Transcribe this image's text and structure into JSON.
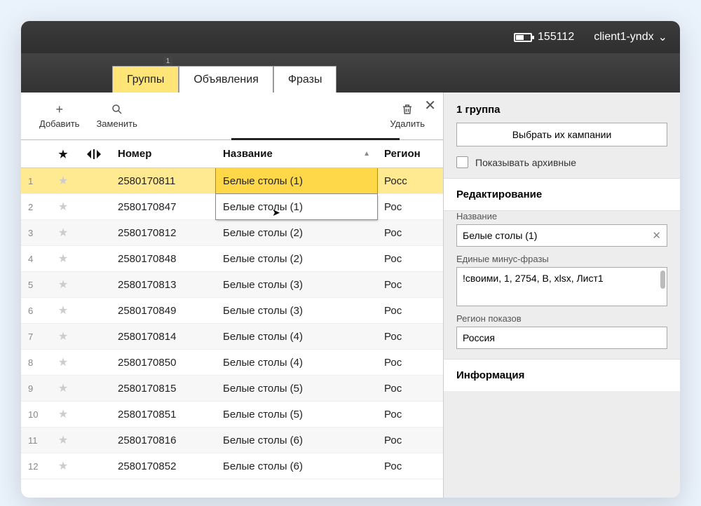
{
  "titlebar": {
    "id": "155112",
    "user": "client1-yndx"
  },
  "tabs": [
    {
      "label": "Группы",
      "active": true,
      "badge": "1"
    },
    {
      "label": "Объявления",
      "active": false
    },
    {
      "label": "Фразы",
      "active": false
    }
  ],
  "toolbar": {
    "add": "Добавить",
    "replace": "Заменить",
    "delete": "Удалить"
  },
  "columns": {
    "number": "Номер",
    "name": "Название",
    "region": "Регион"
  },
  "rows": [
    {
      "idx": "1",
      "num": "2580170811",
      "name": "Белые столы (1)",
      "region": "Росс",
      "selected": true
    },
    {
      "idx": "2",
      "num": "2580170847",
      "name": "Белые столы (1)",
      "region": "Рос",
      "editing": true
    },
    {
      "idx": "3",
      "num": "2580170812",
      "name": "Белые столы (2)",
      "region": "Рос"
    },
    {
      "idx": "4",
      "num": "2580170848",
      "name": "Белые столы (2)",
      "region": "Рос"
    },
    {
      "idx": "5",
      "num": "2580170813",
      "name": "Белые столы (3)",
      "region": "Рос"
    },
    {
      "idx": "6",
      "num": "2580170849",
      "name": "Белые столы (3)",
      "region": "Рос"
    },
    {
      "idx": "7",
      "num": "2580170814",
      "name": "Белые столы (4)",
      "region": "Рос"
    },
    {
      "idx": "8",
      "num": "2580170850",
      "name": "Белые столы (4)",
      "region": "Рос"
    },
    {
      "idx": "9",
      "num": "2580170815",
      "name": "Белые столы (5)",
      "region": "Рос"
    },
    {
      "idx": "10",
      "num": "2580170851",
      "name": "Белые столы (5)",
      "region": "Рос"
    },
    {
      "idx": "11",
      "num": "2580170816",
      "name": "Белые столы (6)",
      "region": "Рос"
    },
    {
      "idx": "12",
      "num": "2580170852",
      "name": "Белые столы (6)",
      "region": "Рос"
    }
  ],
  "side": {
    "title": "1 группа",
    "choose_btn": "Выбрать их кампании",
    "show_archived": "Показывать архивные",
    "editing_title": "Редактирование",
    "name_label": "Название",
    "name_value": "Белые столы (1)",
    "minus_label": "Единые минус-фразы",
    "minus_value": "!своими, 1, 2754, В, xlsx, Лист1",
    "region_label": "Регион показов",
    "region_value": "Россия",
    "info_title": "Информация"
  }
}
